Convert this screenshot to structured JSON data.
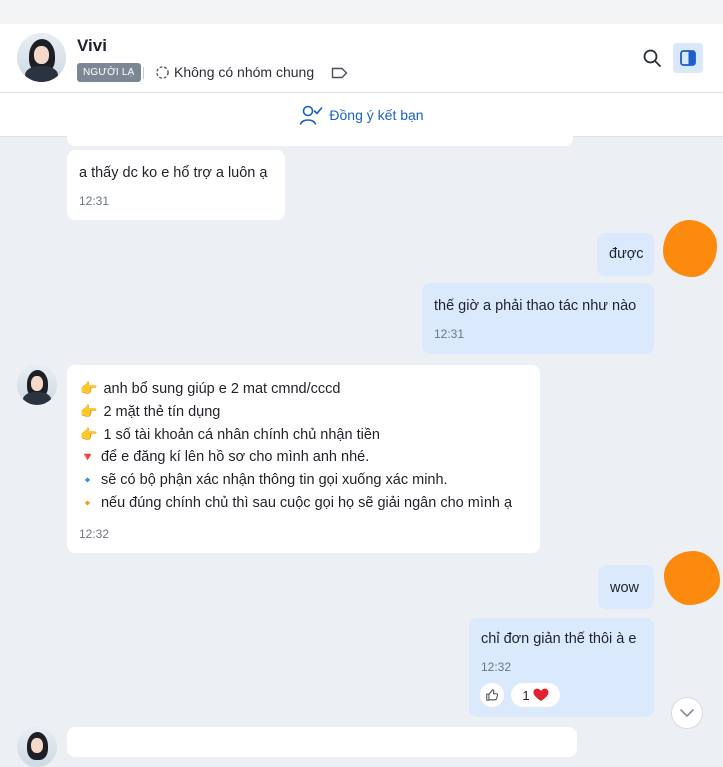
{
  "header": {
    "contact_name": "Vivi",
    "stranger_badge": "NGƯỜI LẠ",
    "group_info": "Không có nhóm chung"
  },
  "friend_bar": {
    "accept_label": "Đồng ý kết bạn"
  },
  "messages": [
    {
      "side": "in",
      "text": "a thấy dc ko e hổ trợ a luôn ạ",
      "time": "12:31"
    },
    {
      "side": "out",
      "text": "được"
    },
    {
      "side": "out",
      "text": "thế giờ a phải thao tác như nào",
      "time": "12:31"
    },
    {
      "side": "in",
      "lines": [
        {
          "icon": "👉",
          "text": "anh bổ sung giúp e 2 mat cmnd/cccd"
        },
        {
          "icon": "👉",
          "text": "2 mặt thẻ tín dụng"
        },
        {
          "icon": "👉",
          "text": "1 số tài khoản cá nhân chính chủ nhận tiền"
        },
        {
          "icon": "🔻",
          "text": "để e đăng kí lên hồ sơ cho mình anh  nhé."
        },
        {
          "icon": "🔹",
          "text": "sẽ có bộ phận xác nhận thông tin gọi xuống xác minh."
        },
        {
          "icon": "🔸",
          "text": "nếu đúng chính chủ thì sau cuộc gọi họ sẽ giải ngân cho mình ạ"
        }
      ],
      "time": "12:32"
    },
    {
      "side": "out",
      "text": "wow"
    },
    {
      "side": "out",
      "text": "chỉ đơn giản thế thôi à e",
      "time": "12:32",
      "reaction_count": "1"
    }
  ],
  "colors": {
    "accent": "#1b5fcf",
    "outgoing_bubble": "#dbe9fc",
    "redaction": "#fb8a0f",
    "heart": "#e5202e"
  }
}
